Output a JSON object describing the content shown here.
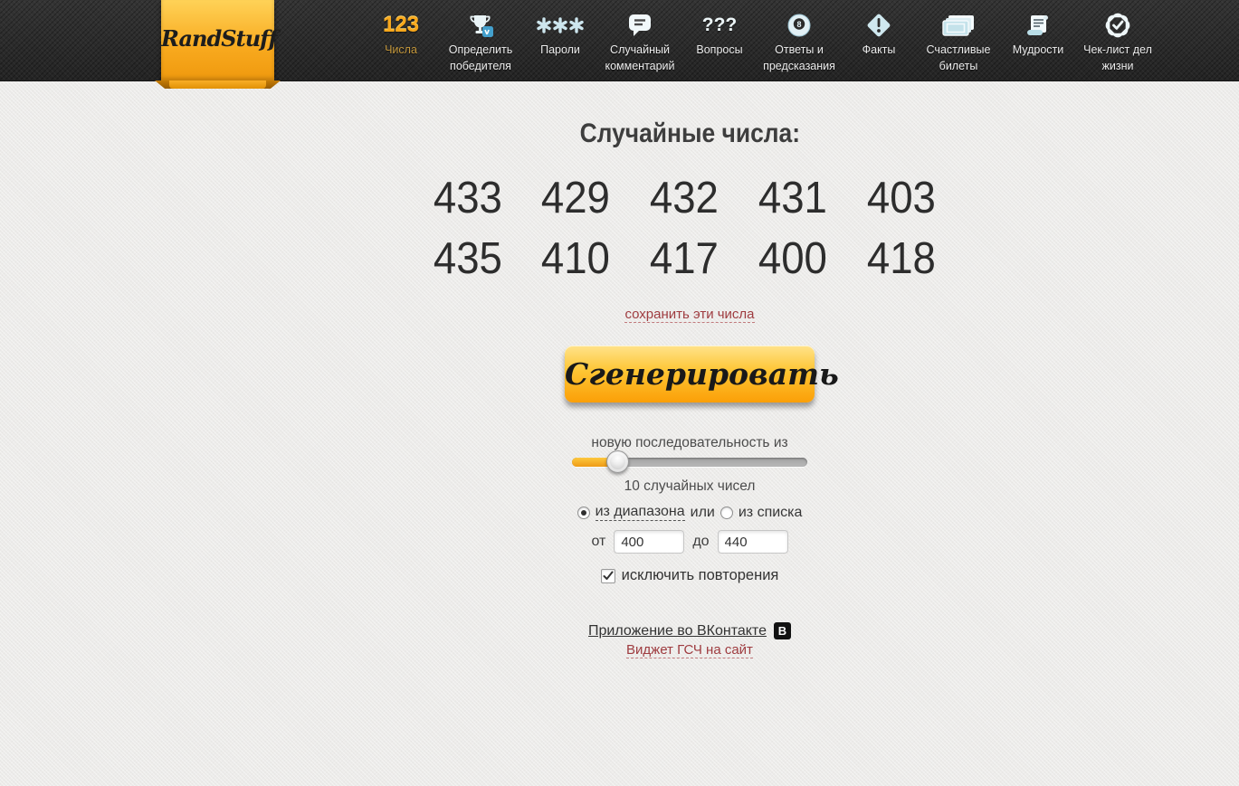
{
  "brand": {
    "logo": "RandStuff"
  },
  "nav": {
    "items": [
      {
        "label": "Числа",
        "icon": "numbers-123-icon",
        "glyph": "123",
        "active": true
      },
      {
        "label": "Определить победителя",
        "icon": "trophy-vk-icon"
      },
      {
        "label": "Пароли",
        "icon": "asterisks-icon"
      },
      {
        "label": "Случайный комментарий",
        "icon": "speech-bubble-icon"
      },
      {
        "label": "Вопросы",
        "icon": "question-marks-icon",
        "glyph": "???"
      },
      {
        "label": "Ответы и предсказания",
        "icon": "magic-eight-ball-icon"
      },
      {
        "label": "Факты",
        "icon": "exclamation-diamond-icon"
      },
      {
        "label": "Счастливые билеты",
        "icon": "tickets-icon"
      },
      {
        "label": "Мудрости",
        "icon": "scroll-icon"
      },
      {
        "label": "Чек-лист дел жизни",
        "icon": "check-seal-icon"
      }
    ]
  },
  "main": {
    "title": "Случайные числа:",
    "numbers": [
      "433",
      "429",
      "432",
      "431",
      "403",
      "435",
      "410",
      "417",
      "400",
      "418"
    ],
    "save_link": "сохранить эти числа",
    "generate_button": "Сгенерировать",
    "slider": {
      "label_above": "новую последовательность из",
      "label_below": "10 случайных чисел",
      "count": 10
    },
    "mode": {
      "range_label": "из диапазона",
      "or_label": "или",
      "list_label": "из списка",
      "range_selected": true,
      "list_selected": false
    },
    "range": {
      "from_label": "от",
      "from_value": "400",
      "to_label": "до",
      "to_value": "440"
    },
    "exclude": {
      "label": "исключить повторения",
      "checked": true
    }
  },
  "footer": {
    "vk_app_link": "Приложение во ВКонтакте",
    "vk_badge_letter": "В",
    "widget_link": "Виджет ГСЧ на сайт"
  },
  "colors": {
    "accent_orange": "#f8a71b",
    "nav_background": "#2c2c2c",
    "link_red": "#9e3b3f",
    "button_gradient_top": "#ffe38b",
    "button_gradient_bottom": "#fb9f07",
    "icon_light_blue": "#cde6ee"
  }
}
